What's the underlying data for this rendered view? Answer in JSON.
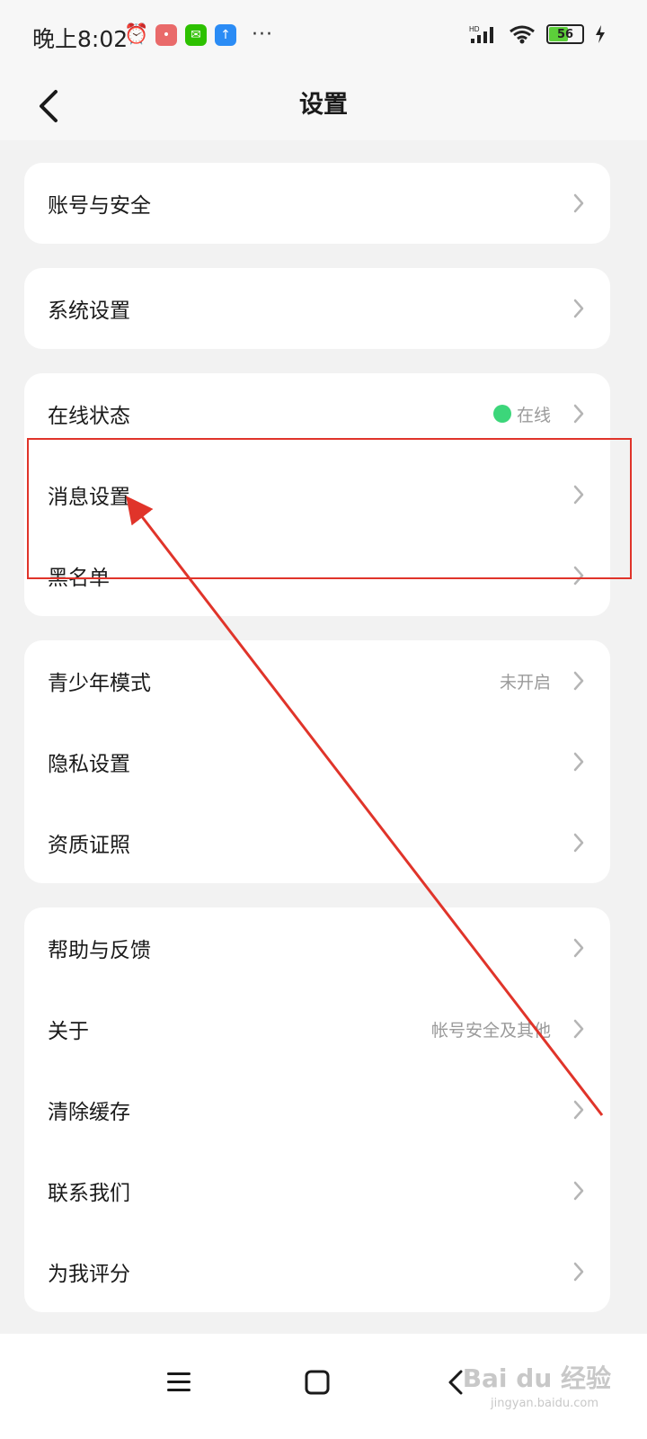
{
  "status_bar": {
    "time": "晚上8:02",
    "battery": "56",
    "network": "HD",
    "more": "···"
  },
  "header": {
    "title": "设置"
  },
  "groups": [
    {
      "items": [
        {
          "label": "账号与安全"
        }
      ]
    },
    {
      "items": [
        {
          "label": "系统设置"
        }
      ]
    },
    {
      "items": [
        {
          "label": "在线状态",
          "value": "在线"
        },
        {
          "label": "消息设置"
        },
        {
          "label": "黑名单"
        }
      ]
    },
    {
      "items": [
        {
          "label": "青少年模式",
          "value": "未开启"
        },
        {
          "label": "隐私设置"
        },
        {
          "label": "资质证照"
        }
      ]
    },
    {
      "items": [
        {
          "label": "帮助与反馈"
        },
        {
          "label": "关于",
          "value": "帐号安全及其他"
        },
        {
          "label": "清除缓存"
        },
        {
          "label": "联系我们"
        },
        {
          "label": "为我评分"
        }
      ]
    }
  ],
  "watermark": {
    "text": "Bai du 经验",
    "sub": "jingyan.baidu.com"
  },
  "colors": {
    "online": "#3cd67a",
    "annotation": "#e0342a",
    "battery": "#5ccf3a"
  }
}
